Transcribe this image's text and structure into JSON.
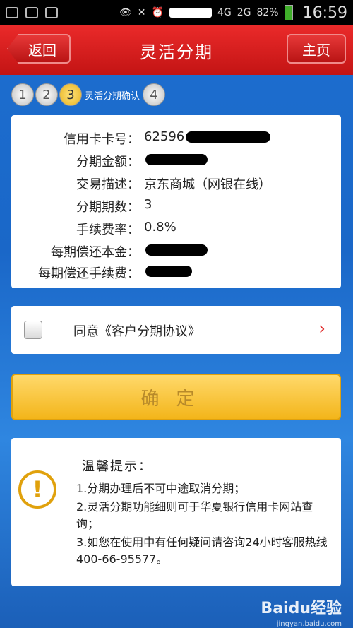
{
  "statusbar": {
    "signal_4g": "4G",
    "signal_2g": "2G",
    "battery_pct": "82%",
    "time": "16:59"
  },
  "header": {
    "back": "返回",
    "title": "灵活分期",
    "home": "主页"
  },
  "steps": {
    "items": [
      "1",
      "2",
      "3",
      "4"
    ],
    "active_label": "灵活分期确认",
    "active_index": 2
  },
  "details": {
    "card_number_label": "信用卡卡号：",
    "card_number_visible": "62596",
    "amount_label": "分期金额：",
    "desc_label": "交易描述：",
    "desc_value": "京东商城（网银在线）",
    "periods_label": "分期期数：",
    "periods_value": "3",
    "fee_rate_label": "手续费率：",
    "fee_rate_value": "0.8%",
    "principal_label": "每期偿还本金：",
    "fee_label": "每期偿还手续费："
  },
  "agreement": {
    "text": "同意《客户分期协议》",
    "checked": false
  },
  "confirm": {
    "label": "确定"
  },
  "tips": {
    "title": "温馨提示：",
    "line1": "1.分期办理后不可中途取消分期；",
    "line2": "2.灵活分期功能细则可于华夏银行信用卡网站查询；",
    "line3": "3.如您在使用中有任何疑问请咨询24小时客服热线400-66-95577。"
  },
  "watermark": {
    "brand": "Baidu经验",
    "url": "jingyan.baidu.com"
  },
  "colors": {
    "header_red": "#d61f1f",
    "confirm_yellow": "#f3b51a",
    "background_blue": "#1d6fd0"
  }
}
